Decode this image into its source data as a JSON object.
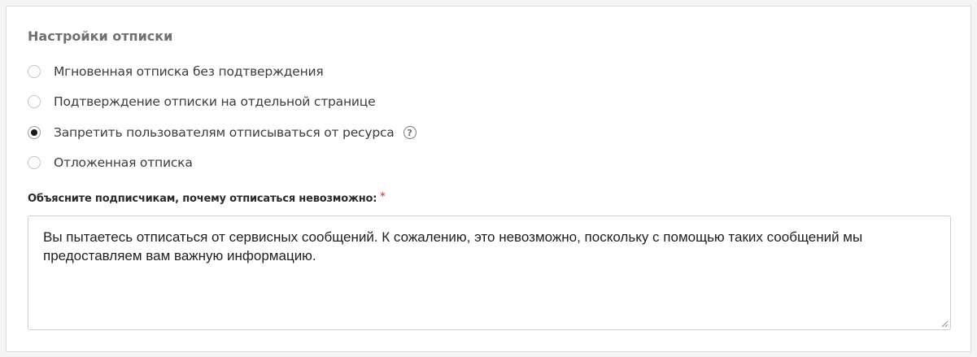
{
  "section": {
    "title": "Настройки отписки"
  },
  "options": [
    {
      "label": "Мгновенная отписка без подтверждения",
      "checked": false
    },
    {
      "label": "Подтверждение отписки на отдельной странице",
      "checked": false
    },
    {
      "label": "Запретить пользователям отписываться от ресурса",
      "checked": true,
      "help_icon": "question-circle-icon"
    },
    {
      "label": "Отложенная отписка",
      "checked": false
    }
  ],
  "explanation": {
    "label": "Объясните подписчикам, почему отписаться невозможно:",
    "required_mark": "*",
    "value": "Вы пытаетесь отписаться от сервисных сообщений. К сожалению, это невозможно, поскольку с помощью таких сообщений мы предоставляем вам важную информацию."
  },
  "colors": {
    "required": "#d9534f",
    "radio_selected": "#1a1a1a"
  }
}
